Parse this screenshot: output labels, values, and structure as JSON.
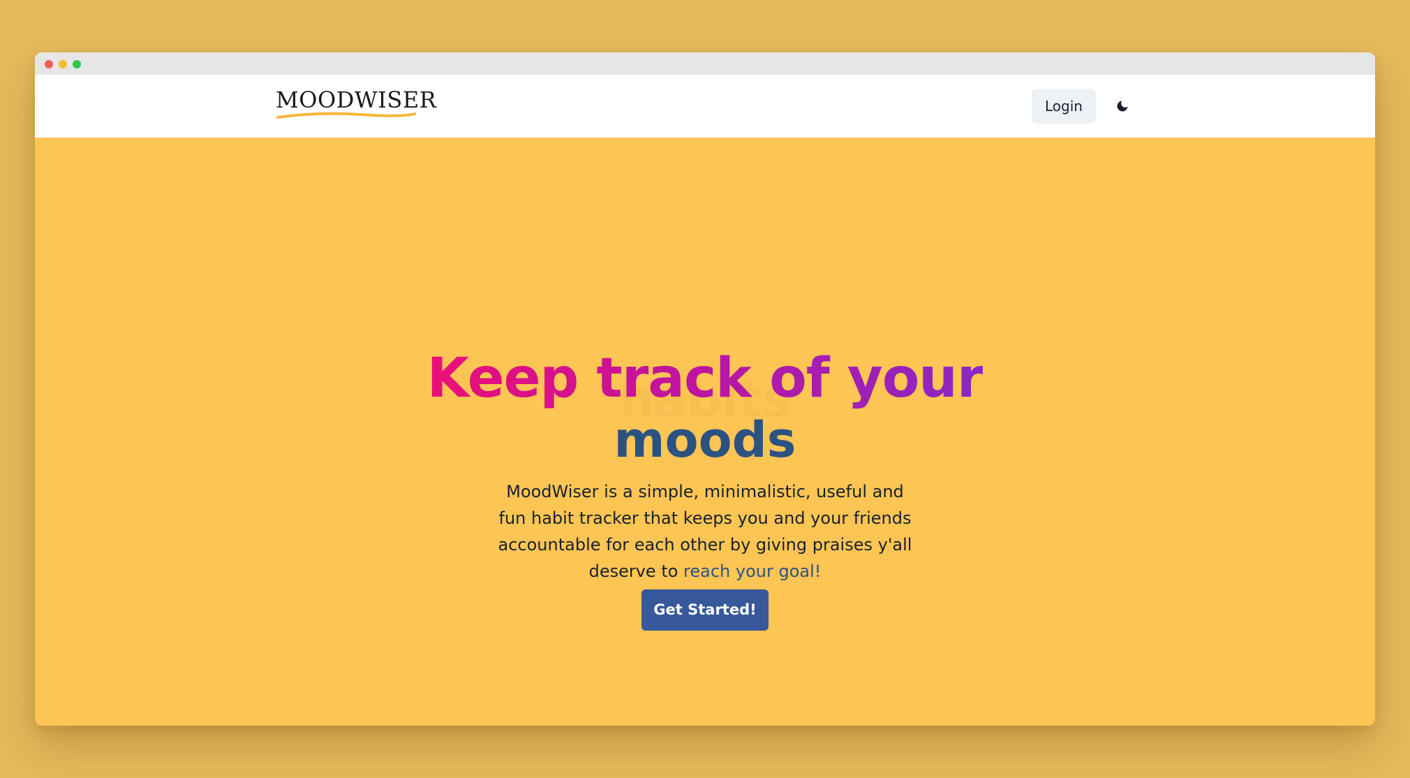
{
  "window": {
    "controls": [
      "close",
      "minimize",
      "maximize"
    ]
  },
  "navbar": {
    "logo_text": "MOODWISER",
    "login_label": "Login",
    "theme_toggle_icon": "moon-icon"
  },
  "hero": {
    "headline": "Keep track of your",
    "ghost_word": "habits",
    "rotating_word": "moods",
    "description_main": "MoodWiser is a simple, minimalistic, useful and fun habit tracker that keeps you and your friends accountable for each other by giving praises y'all deserve to ",
    "description_link": "reach your goal!",
    "cta_label": "Get Started!"
  },
  "colors": {
    "page_background": "#e5ba5c",
    "hero_background": "#fdc554",
    "headline_gradient": [
      "#ec0f77",
      "#c0149f",
      "#8a28c4"
    ],
    "accent_blue": "#2c5282",
    "cta_background": "#37589a",
    "logo_underline": "#f6b73c"
  }
}
